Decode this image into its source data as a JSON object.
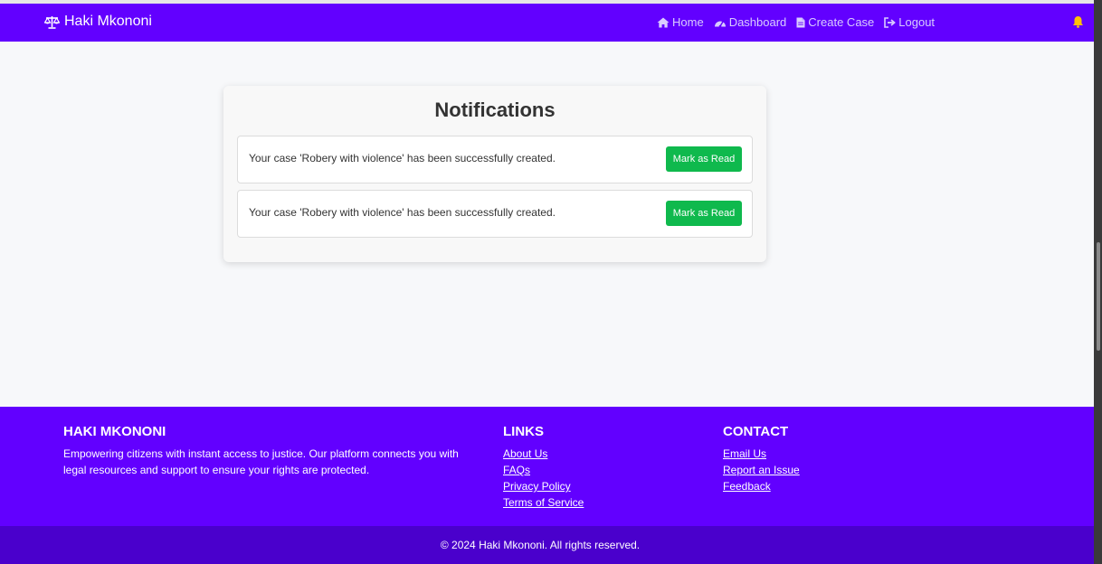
{
  "app": {
    "brand": "Haki Mkononi",
    "brand_icon": "scale-balance-icon",
    "accent_color": "#6200ff"
  },
  "nav": {
    "items": [
      {
        "label": "Home",
        "icon": "home-icon"
      },
      {
        "label": "Dashboard",
        "icon": "dashboard-icon"
      },
      {
        "label": "Create Case",
        "icon": "file-icon"
      },
      {
        "label": "Logout",
        "icon": "logout-icon"
      }
    ],
    "bell_icon": "bell-icon",
    "bell_color": "#ffc107"
  },
  "notifications": {
    "title": "Notifications",
    "items": [
      {
        "message": "Your case 'Robery with violence' has been successfully created.",
        "action": "Mark as Read"
      },
      {
        "message": "Your case 'Robery with violence' has been successfully created.",
        "action": "Mark as Read"
      }
    ],
    "button_color": "#0fb94d"
  },
  "footer": {
    "about": {
      "heading": "HAKI MKONONI",
      "text": "Empowering citizens with instant access to justice. Our platform connects you with legal resources and support to ensure your rights are protected."
    },
    "links": {
      "heading": "LINKS",
      "items": [
        "About Us",
        "FAQs",
        "Privacy Policy",
        "Terms of Service"
      ]
    },
    "contact": {
      "heading": "CONTACT",
      "items": [
        "Email Us",
        "Report an Issue",
        "Feedback"
      ]
    },
    "copyright": "© 2024 Haki Mkononi. All rights reserved."
  }
}
